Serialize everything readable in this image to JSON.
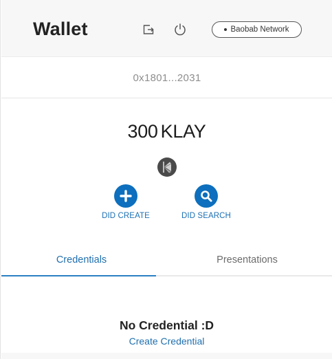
{
  "header": {
    "title": "Wallet",
    "export_icon": "export-icon",
    "power_icon": "power-icon",
    "network_label": "Baobab Network"
  },
  "account": {
    "address": "0x1801...2031"
  },
  "balance": {
    "amount": "300",
    "unit": "KLAY",
    "token_icon": "klaytn-logo-icon"
  },
  "actions": {
    "create_label": "DID CREATE",
    "search_label": "DID SEARCH"
  },
  "tabs": [
    {
      "label": "Credentials",
      "active": true
    },
    {
      "label": "Presentations",
      "active": false
    }
  ],
  "empty_state": {
    "title": "No Credential :D",
    "link": "Create Credential"
  },
  "colors": {
    "accent": "#0d6fbd",
    "link": "#1f6fae",
    "header_bg": "#f7f7f7"
  }
}
